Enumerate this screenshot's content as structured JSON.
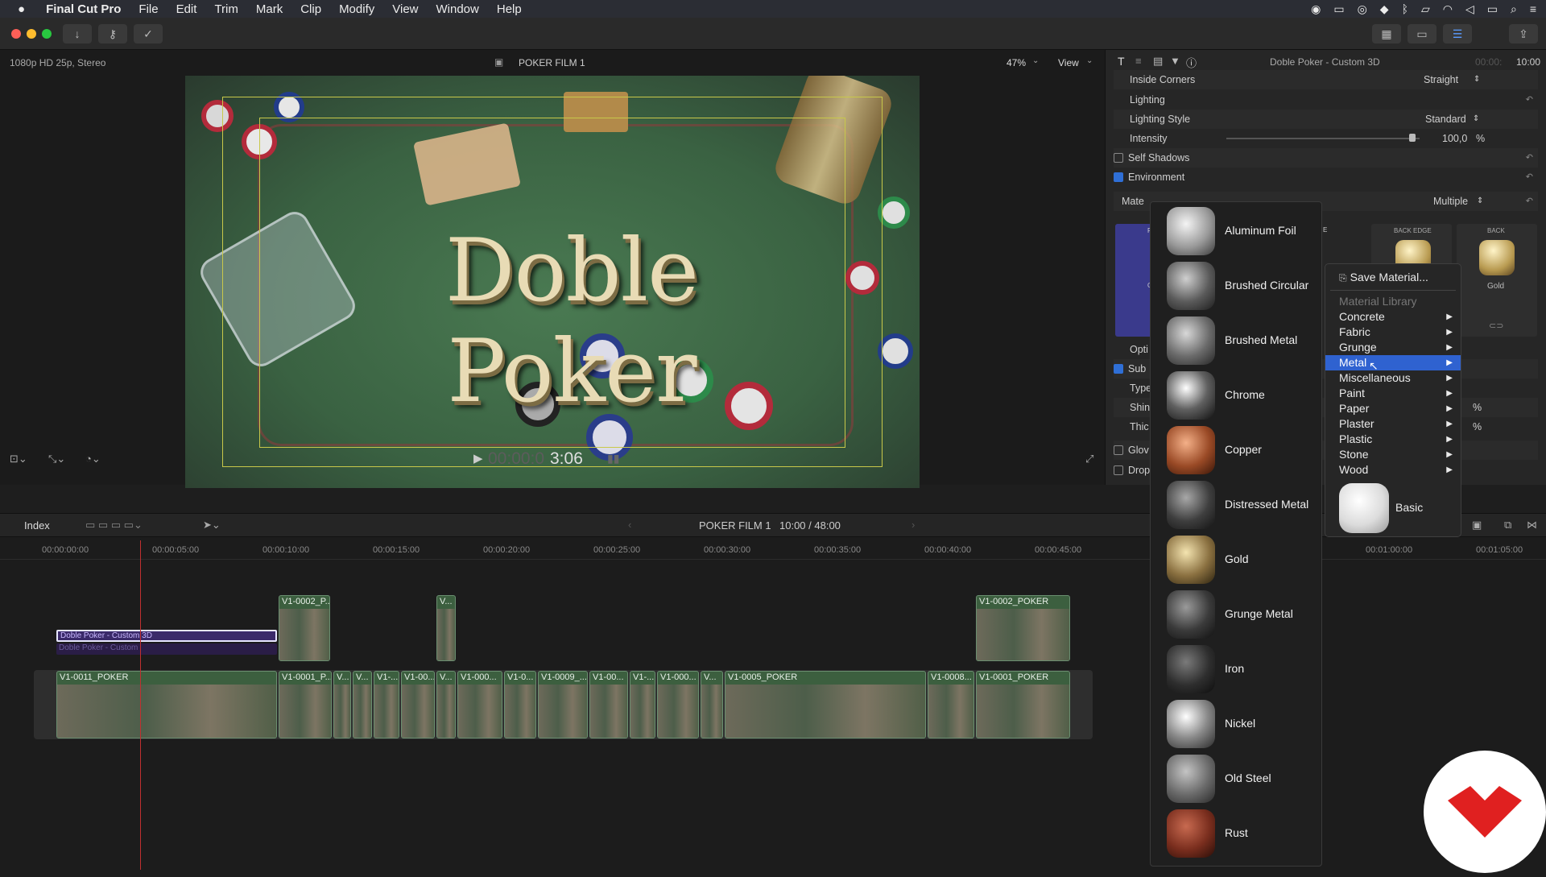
{
  "menubar": {
    "app": "Final Cut Pro",
    "items": [
      "File",
      "Edit",
      "Trim",
      "Mark",
      "Clip",
      "Modify",
      "View",
      "Window",
      "Help"
    ]
  },
  "viewer": {
    "format": "1080p HD 25p, Stereo",
    "project": "POKER FILM 1",
    "zoom": "47%",
    "view_label": "View",
    "timecode_dim": "00:00:0",
    "timecode": "3:06",
    "title_text": "Doble Poker"
  },
  "inspector": {
    "header": "Doble Poker - Custom 3D",
    "duration_dim": "00:00:",
    "duration": "10:00",
    "inside_corners_label": "Inside Corners",
    "inside_corners_value": "Straight",
    "lighting_label": "Lighting",
    "lighting_style_label": "Lighting Style",
    "lighting_style_value": "Standard",
    "intensity_label": "Intensity",
    "intensity_value": "100,0",
    "intensity_unit": "%",
    "self_shadows": "Self Shadows",
    "environment": "Environment",
    "material_label": "Mate",
    "material_value": "Multiple",
    "back_edge": "BACK EDGE",
    "back": "BACK",
    "gold": "Gold",
    "option_row": "Opti",
    "sub_row": "Sub",
    "type_row": "Type",
    "shin_row": "Shin",
    "thic_row": "Thic",
    "glow_row": "Glov",
    "drop_row": "Drop",
    "front_letter": "FI",
    "front_sub": "G",
    "edge_letter": "E",
    "percent_a": "%",
    "percent_b": "%"
  },
  "timeline": {
    "index": "Index",
    "project": "POKER FILM 1",
    "position": "10:00 / 48:00",
    "ticks": [
      "00:00:00:00",
      "00:00:05:00",
      "00:00:10:00",
      "00:00:15:00",
      "00:00:20:00",
      "00:00:25:00",
      "00:00:30:00",
      "00:00:35:00",
      "00:00:40:00",
      "00:00:45:00",
      "00:01:00:00",
      "00:01:05:00"
    ],
    "title_clip": "Doble Poker - Custom 3D",
    "title_clip_shadow": "Doble Poker - Custom",
    "upper_clips": [
      "V1-0002_P...",
      "V...",
      "V1-0002_POKER"
    ],
    "main_clips": [
      "V1-0011_POKER",
      "V1-0001_P...",
      "V...",
      "V...",
      "V1-...",
      "V1-00...",
      "V...",
      "V1-000...",
      "V1-0...",
      "V1-0009_...",
      "V1-00...",
      "V1-...",
      "V1-000...",
      "V...",
      "V1-0005_POKER",
      "V1-0008...",
      "V1-0001_POKER"
    ]
  },
  "materials": [
    "Aluminum Foil",
    "Brushed Circular",
    "Brushed Metal",
    "Chrome",
    "Copper",
    "Distressed Metal",
    "Gold",
    "Grunge Metal",
    "Iron",
    "Nickel",
    "Old Steel",
    "Rust"
  ],
  "context_menu": {
    "save": "Save Material...",
    "library": "Material Library",
    "items": [
      "Concrete",
      "Fabric",
      "Grunge",
      "Metal",
      "Miscellaneous",
      "Paint",
      "Paper",
      "Plaster",
      "Plastic",
      "Stone",
      "Wood"
    ],
    "selected": "Metal",
    "basic": "Basic"
  },
  "colors": {
    "accent": "#2f62d0",
    "logo_red": "#e02020"
  }
}
